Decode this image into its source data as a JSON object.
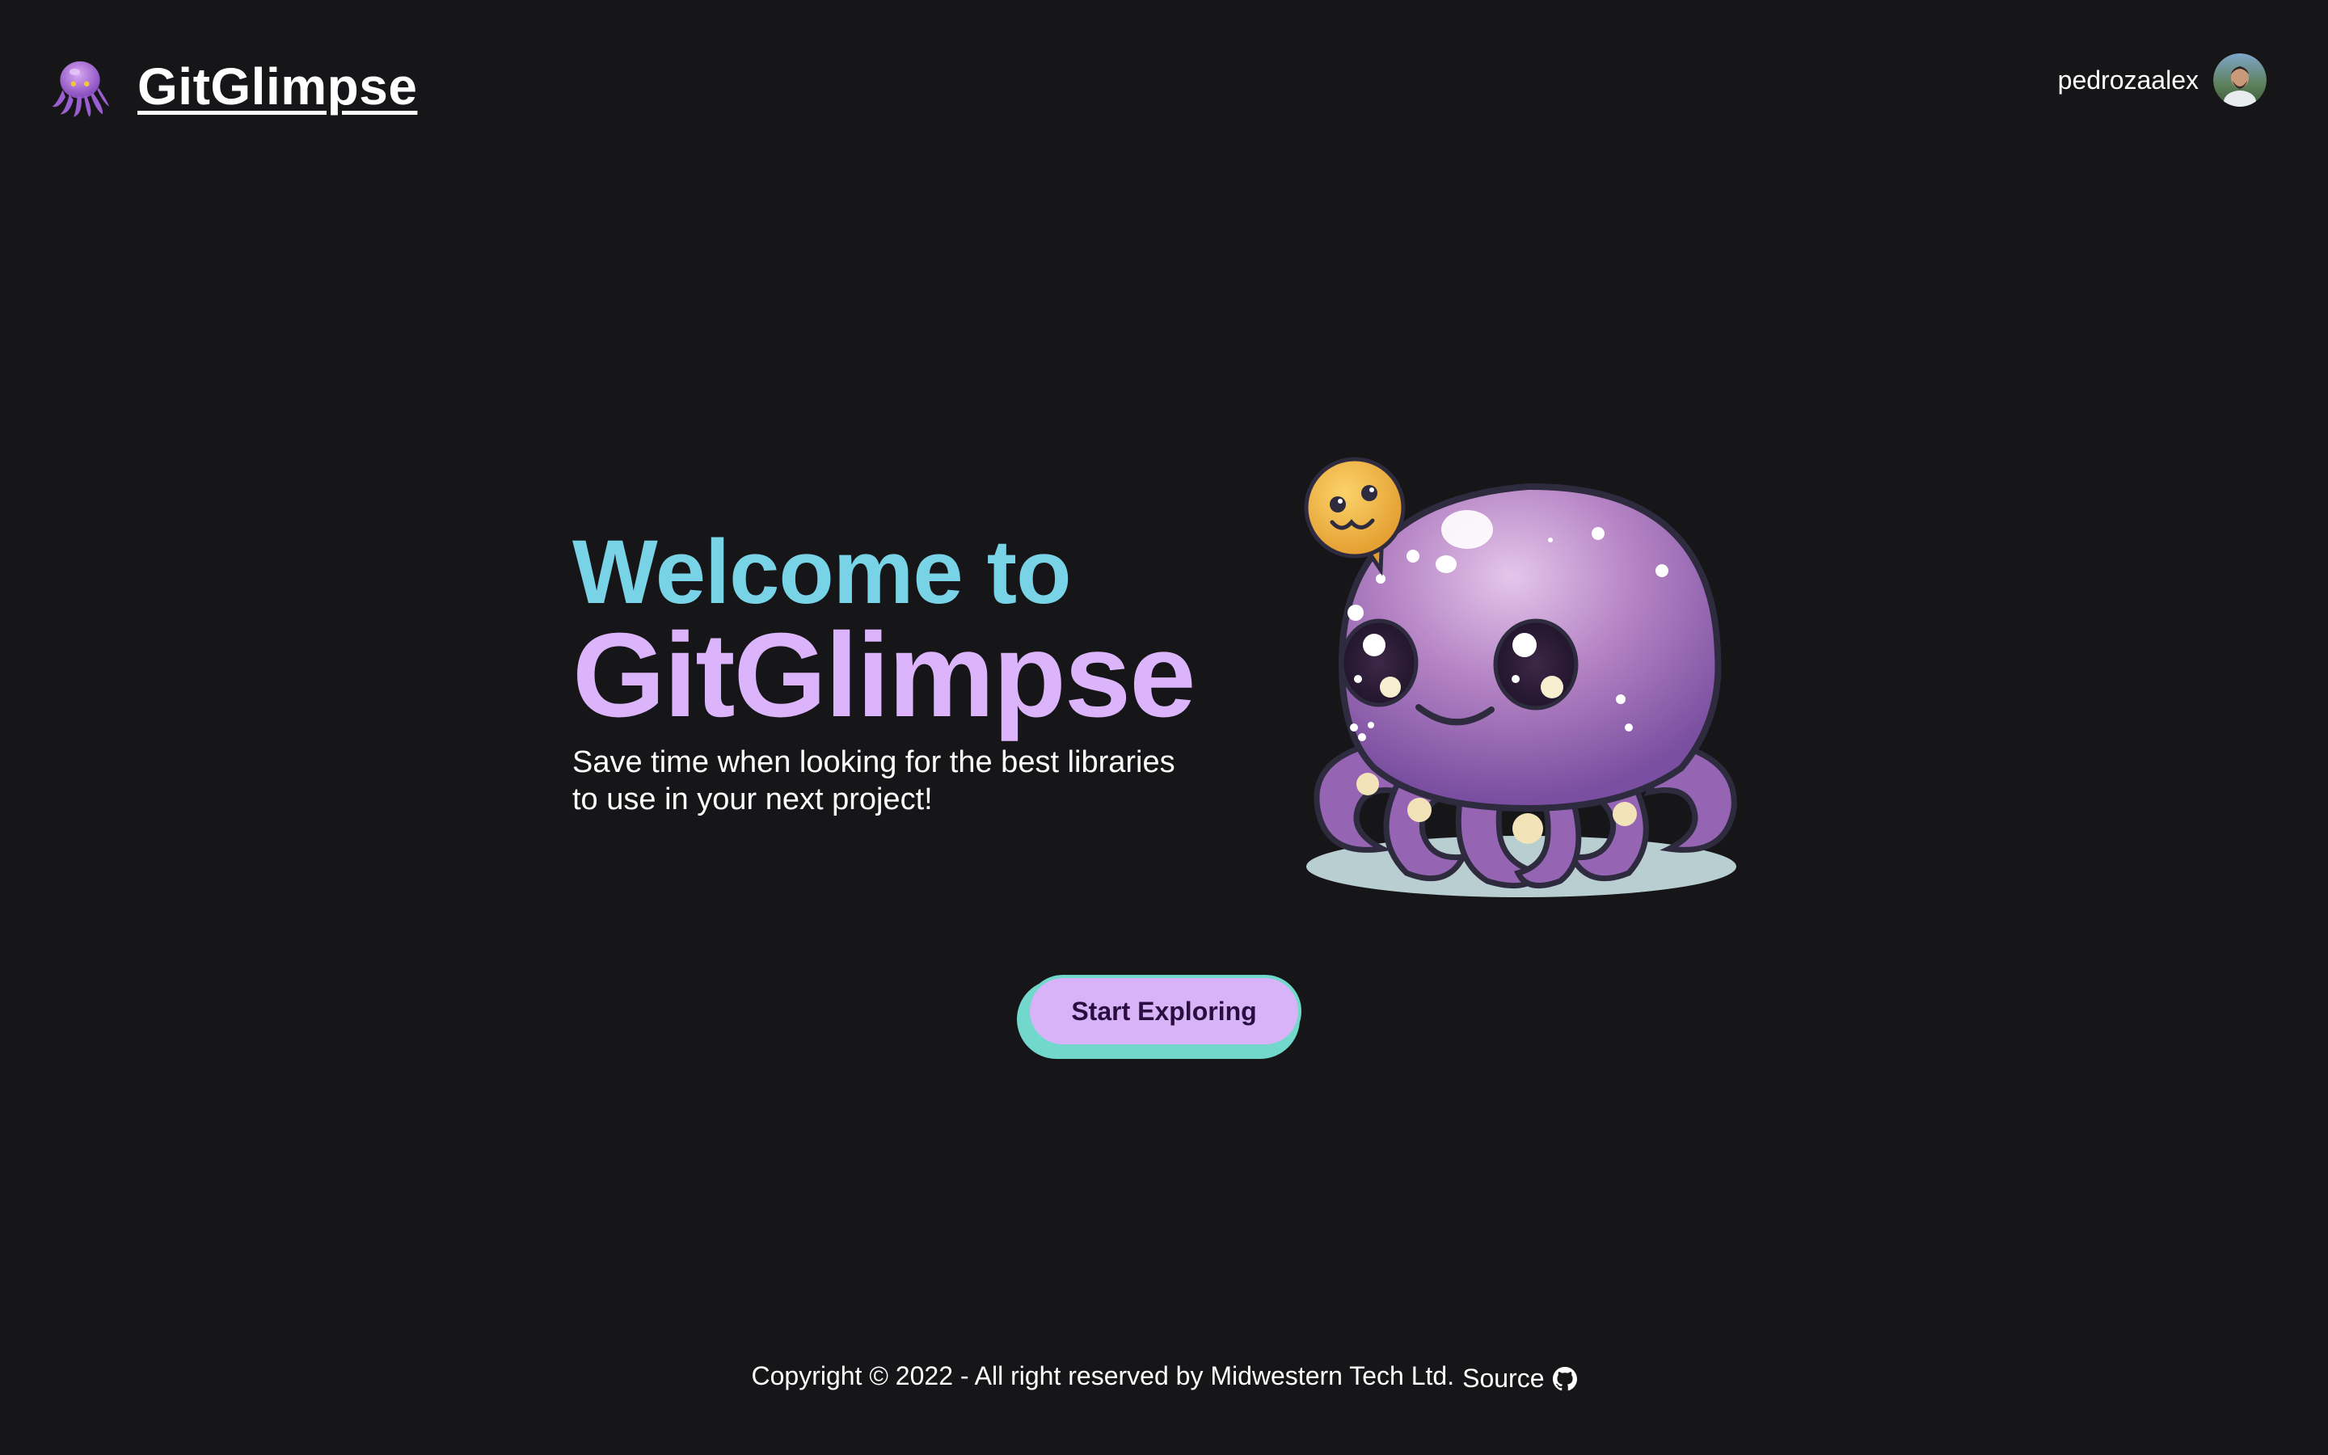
{
  "header": {
    "brand_title": "GitGlimpse",
    "logo_icon": "octopus-icon",
    "username": "pedrozaalex",
    "avatar_icon": "user-avatar"
  },
  "hero": {
    "welcome": "Welcome to",
    "name": "GitGlimpse",
    "subtitle": "Save time when looking for the best libraries to use in your next project!",
    "mascot": "octopus-mascot-illustration"
  },
  "cta": {
    "label": "Start Exploring"
  },
  "footer": {
    "copyright": "Copyright © 2022 - All right reserved by Midwestern Tech Ltd.",
    "source_label": "Source",
    "source_icon": "github-icon"
  },
  "colors": {
    "background": "#161618",
    "welcome": "#79d3e7",
    "brand_accent": "#dcb4fb",
    "cta_fill": "#d8b3f8",
    "cta_border": "#72d8cb"
  }
}
